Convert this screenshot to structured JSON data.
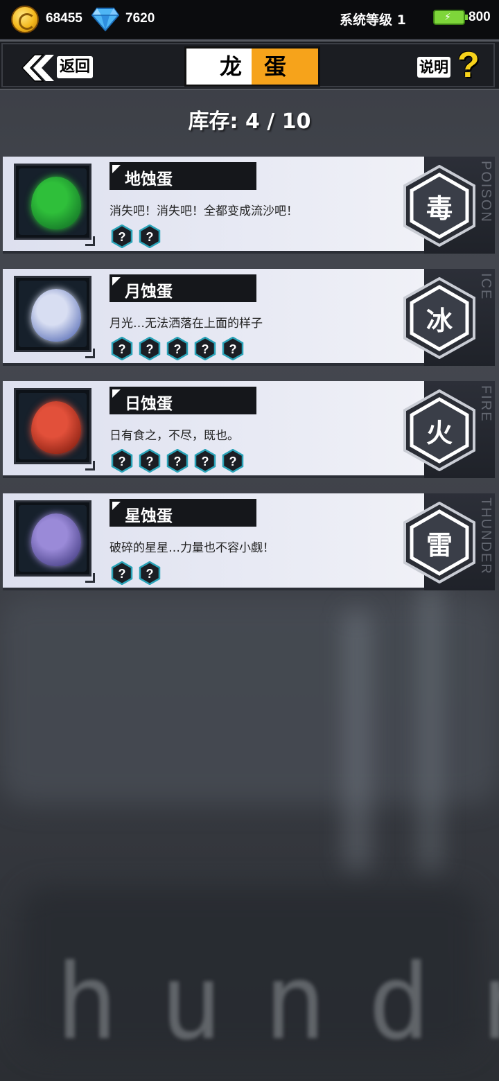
{
  "currency": {
    "coins": "68455",
    "gems": "7620",
    "energy": "800"
  },
  "system_level": "系统等级 1",
  "header": {
    "back_label": "返回",
    "title_left": "龙",
    "title_right": "蛋",
    "help_label": "说明",
    "help_icon_glyph": "?"
  },
  "inventory": {
    "label": "库存:",
    "count": "4 / 10"
  },
  "eggs": [
    {
      "name": "地蚀蛋",
      "description": "消失吧！消失吧！全都变成流沙吧！",
      "unknown_slots": 2,
      "element_char": "毒",
      "element_word": "POISON",
      "egg_colors": [
        "#2fbf3a",
        "#0c5e22"
      ]
    },
    {
      "name": "月蚀蛋",
      "description": "月光…无法洒落在上面的样子",
      "unknown_slots": 5,
      "element_char": "冰",
      "element_word": "ICE",
      "egg_colors": [
        "#d8def2",
        "#3a53a8"
      ]
    },
    {
      "name": "日蚀蛋",
      "description": "日有食之，不尽，既也。",
      "unknown_slots": 5,
      "element_char": "火",
      "element_word": "FIRE",
      "egg_colors": [
        "#e2503a",
        "#6e1206"
      ]
    },
    {
      "name": "星蚀蛋",
      "description": "破碎的星星…力量也不容小觑！",
      "unknown_slots": 2,
      "element_char": "雷",
      "element_word": "THUNDER",
      "egg_colors": [
        "#9a8ad8",
        "#2f2a6e"
      ]
    }
  ],
  "background_text": "hundr"
}
